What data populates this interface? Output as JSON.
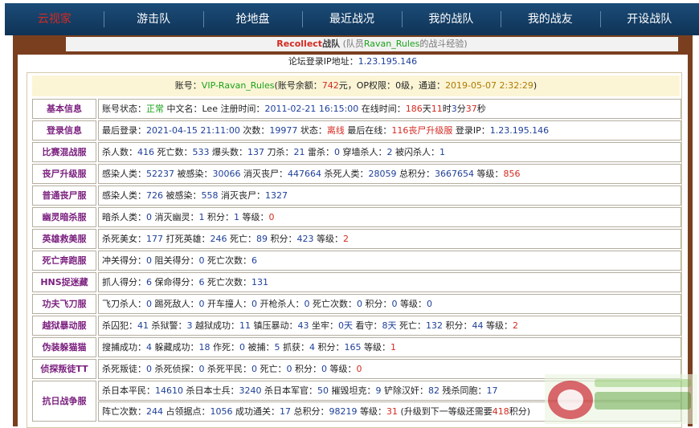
{
  "nav": [
    "云视家",
    "游击队",
    "抢地盘",
    "最近战况",
    "我的战队",
    "我的战友",
    "开设战队"
  ],
  "subtitle": {
    "team": "Recollect",
    "team_suffix": "战队",
    "pre": "(队员",
    "member": "Ravan_Rules",
    "post": "的战斗经验)"
  },
  "ip_line": {
    "label": "论坛登录IP地址：",
    "ip": "1.23.195.146"
  },
  "account": {
    "p1": "账号：",
    "name": "VIP-Ravan_Rules",
    "p2": "(账号余额：",
    "balance": "742",
    "p3": "元，OP权限：",
    "op": "0",
    "p4": "级，通道：",
    "channel_time": "2019-05-07 2:32:29",
    "p5": ")"
  },
  "rows": [
    {
      "label": "基本信息",
      "segs": [
        [
          "账号状态：",
          ""
        ],
        [
          "正常",
          "grn"
        ],
        [
          " 中文名：Lee 注册时间：",
          ""
        ],
        [
          "2011-02-21 16:15:00",
          "num"
        ],
        [
          " 在线时间：",
          ""
        ],
        [
          "186",
          "numred"
        ],
        [
          "天",
          ""
        ],
        [
          "11",
          "numred"
        ],
        [
          "时",
          ""
        ],
        [
          "3",
          "num"
        ],
        [
          "分",
          ""
        ],
        [
          "37",
          "numred"
        ],
        [
          "秒",
          ""
        ]
      ]
    },
    {
      "label": "登录信息",
      "segs": [
        [
          "最后登录：",
          ""
        ],
        [
          "2021-04-15 21:11:00",
          "num"
        ],
        [
          " 次数：",
          ""
        ],
        [
          "19977",
          "num"
        ],
        [
          " 状态：",
          ""
        ],
        [
          "离线",
          "numred"
        ],
        [
          " 最后在线：",
          ""
        ],
        [
          "116丧尸升级服",
          "numred"
        ],
        [
          " 登录IP：",
          ""
        ],
        [
          "1.23.195.146",
          "num"
        ]
      ]
    },
    {
      "label": "比赛混战服",
      "segs": [
        [
          "杀人数：",
          ""
        ],
        [
          "416",
          "num"
        ],
        [
          " 死亡数：",
          ""
        ],
        [
          "533",
          "num"
        ],
        [
          " 爆头数：",
          ""
        ],
        [
          "137",
          "num"
        ],
        [
          " 刀杀：",
          ""
        ],
        [
          "21",
          "num"
        ],
        [
          " 雷杀：",
          ""
        ],
        [
          "0",
          "num"
        ],
        [
          " 穿墙杀人：",
          ""
        ],
        [
          "2",
          "num"
        ],
        [
          " 被闪杀人：",
          ""
        ],
        [
          "1",
          "num"
        ]
      ]
    },
    {
      "label": "丧尸升级服",
      "segs": [
        [
          "感染人类：",
          ""
        ],
        [
          "52237",
          "num"
        ],
        [
          " 被感染：",
          ""
        ],
        [
          "30066",
          "num"
        ],
        [
          " 消灭丧尸：",
          ""
        ],
        [
          "447664",
          "num"
        ],
        [
          " 杀死人类：",
          ""
        ],
        [
          "28059",
          "num"
        ],
        [
          " 总积分：",
          ""
        ],
        [
          "3667654",
          "num"
        ],
        [
          " 等级：",
          ""
        ],
        [
          "856",
          "numred"
        ]
      ]
    },
    {
      "label": "普通丧尸服",
      "segs": [
        [
          "感染人类：",
          ""
        ],
        [
          "726",
          "num"
        ],
        [
          " 被感染：",
          ""
        ],
        [
          "558",
          "num"
        ],
        [
          " 消灭丧尸：",
          ""
        ],
        [
          "1327",
          "num"
        ]
      ]
    },
    {
      "label": "幽灵暗杀服",
      "segs": [
        [
          "暗杀人类：",
          ""
        ],
        [
          "0",
          "num"
        ],
        [
          " 消灭幽灵：",
          ""
        ],
        [
          "1",
          "num"
        ],
        [
          " 积分：",
          ""
        ],
        [
          "1",
          "num"
        ],
        [
          " 等级：",
          ""
        ],
        [
          "0",
          "numred"
        ]
      ]
    },
    {
      "label": "英雄救美服",
      "segs": [
        [
          "杀死美女：",
          ""
        ],
        [
          "177",
          "num"
        ],
        [
          " 打死英雄：",
          ""
        ],
        [
          "246",
          "num"
        ],
        [
          " 死亡：",
          ""
        ],
        [
          "89",
          "num"
        ],
        [
          " 积分：",
          ""
        ],
        [
          "423",
          "num"
        ],
        [
          " 等级：",
          ""
        ],
        [
          "2",
          "numred"
        ]
      ]
    },
    {
      "label": "死亡奔跑服",
      "segs": [
        [
          "冲关得分：",
          ""
        ],
        [
          "0",
          "num"
        ],
        [
          " 阻关得分：",
          ""
        ],
        [
          "0",
          "num"
        ],
        [
          " 死亡次数：",
          ""
        ],
        [
          "6",
          "num"
        ]
      ]
    },
    {
      "label": "HNS捉迷藏",
      "segs": [
        [
          "抓人得分：",
          ""
        ],
        [
          "6",
          "num"
        ],
        [
          " 保命得分：",
          ""
        ],
        [
          "6",
          "num"
        ],
        [
          " 死亡次数：",
          ""
        ],
        [
          "131",
          "num"
        ]
      ]
    },
    {
      "label": "功夫飞刀服",
      "segs": [
        [
          "飞刀杀人：",
          ""
        ],
        [
          "0",
          "num"
        ],
        [
          " 踢死敌人：",
          ""
        ],
        [
          "0",
          "num"
        ],
        [
          " 开车撞人：",
          ""
        ],
        [
          "0",
          "num"
        ],
        [
          " 开枪杀人：",
          ""
        ],
        [
          "0",
          "num"
        ],
        [
          " 死亡次数：",
          ""
        ],
        [
          "0",
          "num"
        ],
        [
          " 积分：",
          ""
        ],
        [
          "0",
          "num"
        ],
        [
          " 等级：",
          ""
        ],
        [
          "0",
          "num"
        ]
      ]
    },
    {
      "label": "越狱暴动服",
      "segs": [
        [
          "杀囚犯：",
          ""
        ],
        [
          "41",
          "num"
        ],
        [
          " 杀狱警：",
          ""
        ],
        [
          "3",
          "num"
        ],
        [
          " 越狱成功：",
          ""
        ],
        [
          "11",
          "num"
        ],
        [
          " 镇压暴动：",
          ""
        ],
        [
          "43",
          "num"
        ],
        [
          " 坐牢：",
          ""
        ],
        [
          "0天",
          "num"
        ],
        [
          " 看守：",
          ""
        ],
        [
          "8天",
          "num"
        ],
        [
          " 死亡：",
          ""
        ],
        [
          "132",
          "num"
        ],
        [
          " 积分：",
          ""
        ],
        [
          "44",
          "num"
        ],
        [
          " 等级：",
          ""
        ],
        [
          "2",
          "numred"
        ]
      ]
    },
    {
      "label": "伪装躲猫猫",
      "segs": [
        [
          "搜捕成功：",
          ""
        ],
        [
          "4",
          "num"
        ],
        [
          " 躲藏成功：",
          ""
        ],
        [
          "18",
          "num"
        ],
        [
          " 作死：",
          ""
        ],
        [
          "0",
          "num"
        ],
        [
          " 被捕：",
          ""
        ],
        [
          "5",
          "num"
        ],
        [
          " 抓获：",
          ""
        ],
        [
          "4",
          "num"
        ],
        [
          " 积分：",
          ""
        ],
        [
          "165",
          "num"
        ],
        [
          " 等级：",
          ""
        ],
        [
          "1",
          "numred"
        ]
      ]
    },
    {
      "label": "侦探叛徒TT",
      "segs": [
        [
          "杀死叛徒：",
          ""
        ],
        [
          "0",
          "num"
        ],
        [
          " 杀死侦探：",
          ""
        ],
        [
          "0",
          "num"
        ],
        [
          " 杀死平民：",
          ""
        ],
        [
          "0",
          "num"
        ],
        [
          " 死亡：",
          ""
        ],
        [
          "0",
          "num"
        ],
        [
          " 积分：",
          ""
        ],
        [
          "0",
          "num"
        ],
        [
          " 等级：",
          ""
        ],
        [
          "0",
          "numred"
        ]
      ]
    }
  ],
  "last_row": {
    "label": "抗日战争服",
    "line1": [
      [
        "杀日本平民：",
        ""
      ],
      [
        "14610",
        "num"
      ],
      [
        " 杀日本士兵：",
        ""
      ],
      [
        "3240",
        "num"
      ],
      [
        " 杀日本军官：",
        ""
      ],
      [
        "50",
        "num"
      ],
      [
        " 摧毁坦克：",
        ""
      ],
      [
        "9",
        "num"
      ],
      [
        " 铲除汉奸：",
        ""
      ],
      [
        "82",
        "num"
      ],
      [
        " 残杀同胞：",
        ""
      ],
      [
        "17",
        "num"
      ]
    ],
    "line2": [
      [
        "阵亡次数：",
        ""
      ],
      [
        "244",
        "num"
      ],
      [
        " 占领据点：",
        ""
      ],
      [
        "1056",
        "num"
      ],
      [
        " 成功通关：",
        ""
      ],
      [
        "17",
        "num"
      ],
      [
        " 总积分：",
        ""
      ],
      [
        "98219",
        "num"
      ],
      [
        " 等级：",
        ""
      ],
      [
        "31",
        "numred"
      ],
      [
        " (升级到下一等级还需要",
        ""
      ],
      [
        "418",
        "numred"
      ],
      [
        "积分)",
        ""
      ]
    ]
  },
  "colors": {
    "nav_bg": "#123a62",
    "frame": "#7a3f1f",
    "label": "#7a1f7e",
    "num": "#1e3f99",
    "red": "#d42a20",
    "green": "#1aa31a"
  }
}
